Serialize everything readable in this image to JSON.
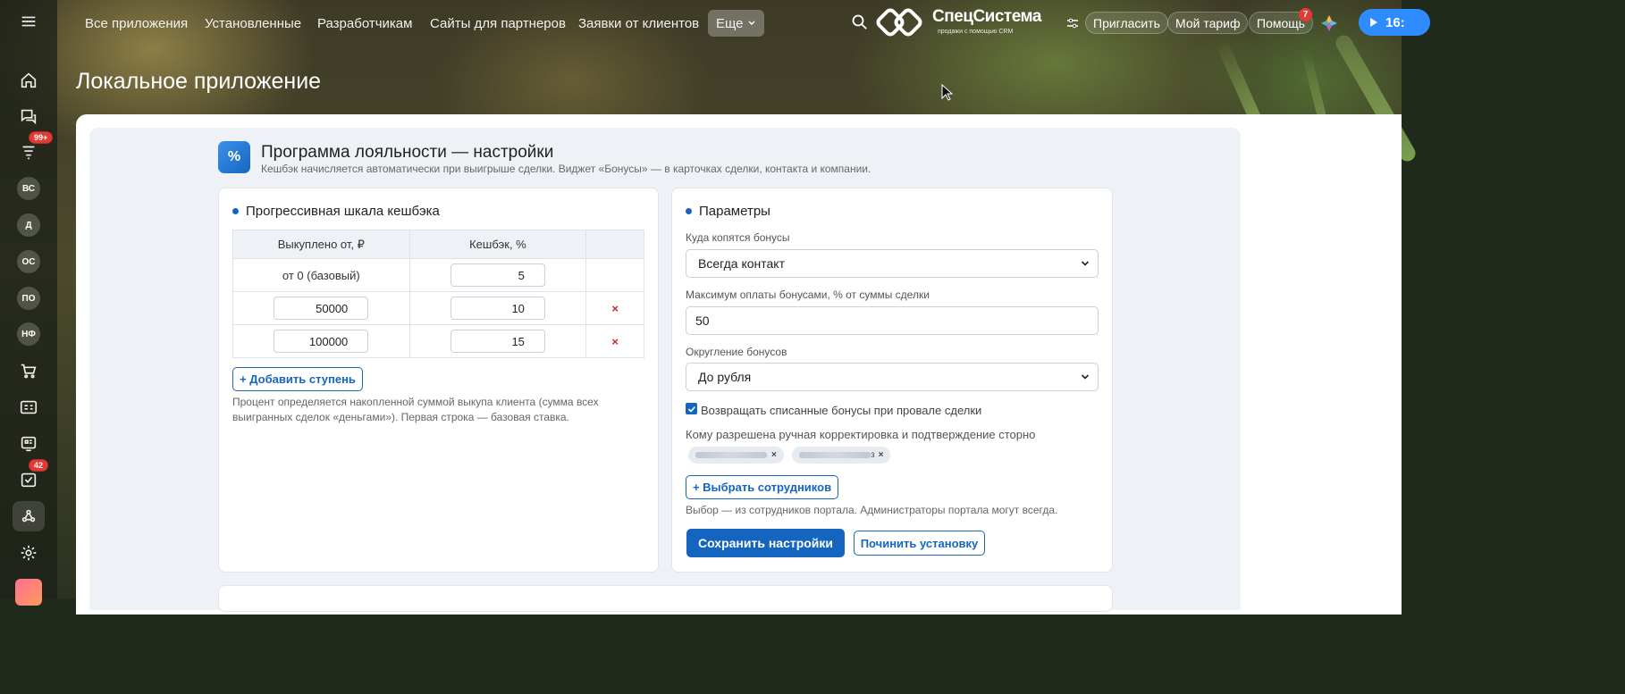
{
  "topbar": {
    "nav": [
      "Все приложения",
      "Установленные",
      "Разработчикам",
      "Сайты для партнеров",
      "Заявки от клиентов"
    ],
    "more_label": "Еще",
    "logo_title": "СпецСистема",
    "logo_sub": "продажи с помощью CRM",
    "invite_label": "Пригласить",
    "tariff_label": "Мой тариф",
    "help_label": "Помощь",
    "help_badge": "7",
    "time_label": "16:"
  },
  "sidebar": {
    "avatars": [
      "ВС",
      "Д",
      "ОС",
      "ПО",
      "НФ"
    ],
    "feed_badge": "99+",
    "tasks_badge": "42"
  },
  "page": {
    "title": "Локальное приложение"
  },
  "app": {
    "icon_label": "%",
    "title": "Программа лояльности — настройки",
    "subtitle": "Кешбэк начисляется автоматически при выигрыше сделки. Виджет «Бонусы» — в карточках сделки, контакта и компании.",
    "scale": {
      "title": "Прогрессивная шкала кешбэка",
      "col_from": "Выкуплено от, ₽",
      "col_pct": "Кешбэк, %",
      "base_label": "от 0 (базовый)",
      "rows": [
        {
          "from": "",
          "pct": "5"
        },
        {
          "from": "50000",
          "pct": "10"
        },
        {
          "from": "100000",
          "pct": "15"
        }
      ],
      "delete_symbol": "×",
      "add_label": "+ Добавить ступень",
      "note": "Процент определяется накопленной суммой выкупа клиента (сумма всех выигранных сделок «деньгами»). Первая строка — базовая ставка."
    },
    "params": {
      "title": "Параметры",
      "accrual_label": "Куда копятся бонусы",
      "accrual_value": "Всегда контакт",
      "max_label": "Максимум оплаты бонусами, % от суммы сделки",
      "max_value": "50",
      "rounding_label": "Округление бонусов",
      "rounding_value": "До рубля",
      "return_label": "Возвращать списанные бонусы при провале сделки",
      "return_checked": true,
      "users_label": "Кому разрешена ручная корректировка и подтверждение сторно",
      "chip_close": "×",
      "chip2_tail": "з",
      "choose_label": "+ Выбрать сотрудников",
      "choose_note": "Выбор — из сотрудников портала. Администраторы портала могут всегда.",
      "save_label": "Сохранить настройки",
      "repair_label": "Починить установку"
    }
  },
  "colors": {
    "accent": "#1565c0",
    "danger": "#c62828",
    "panel_bg": "#eef2f6"
  }
}
